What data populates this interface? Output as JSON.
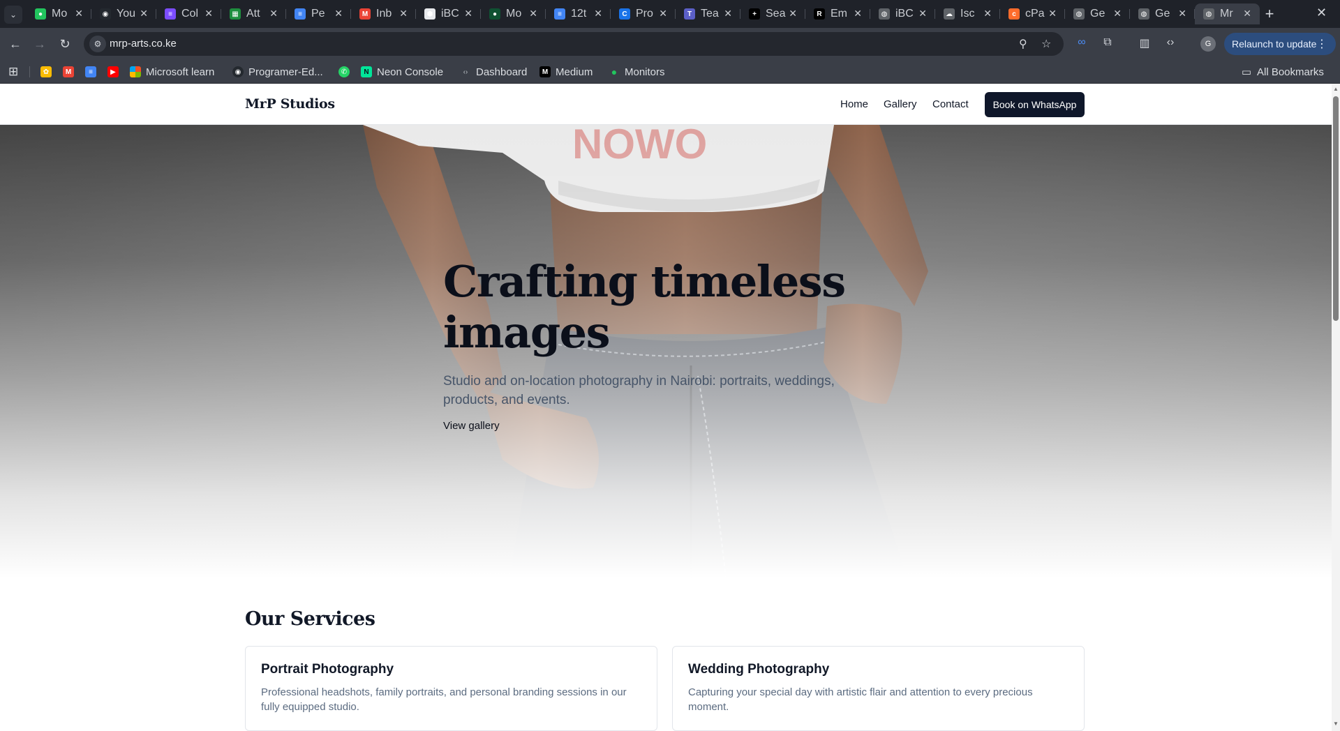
{
  "browser": {
    "tabs": [
      {
        "title": "Mo",
        "icon": "green-dot",
        "color": "#22c55e",
        "glyph": "●"
      },
      {
        "title": "You",
        "icon": "github",
        "color": "#24292f",
        "glyph": "◉"
      },
      {
        "title": "Col",
        "icon": "forms",
        "color": "#7c4dff",
        "glyph": "≡"
      },
      {
        "title": "Att",
        "icon": "sheets",
        "color": "#1e8e3e",
        "glyph": "▦"
      },
      {
        "title": "Pe",
        "icon": "docs",
        "color": "#4285f4",
        "glyph": "≡"
      },
      {
        "title": "Inb",
        "icon": "gmail",
        "color": "#ea4335",
        "glyph": "M"
      },
      {
        "title": "iBC",
        "icon": "ibc",
        "color": "#e8eaed",
        "glyph": "⬢"
      },
      {
        "title": "Mo",
        "icon": "mongo",
        "color": "#0f5132",
        "glyph": "●"
      },
      {
        "title": "12t",
        "icon": "docs",
        "color": "#4285f4",
        "glyph": "≡"
      },
      {
        "title": "Pro",
        "icon": "project",
        "color": "#1a73e8",
        "glyph": "C"
      },
      {
        "title": "Tea",
        "icon": "teams",
        "color": "#5b5fc7",
        "glyph": "T"
      },
      {
        "title": "Sea",
        "icon": "search-plus",
        "color": "#000000",
        "glyph": "+"
      },
      {
        "title": "Em",
        "icon": "r-logo",
        "color": "#000000",
        "glyph": "R"
      },
      {
        "title": "iBC",
        "icon": "globe",
        "color": "#5f6368",
        "glyph": "◍"
      },
      {
        "title": "Isc",
        "icon": "cloud",
        "color": "#5f6368",
        "glyph": "☁"
      },
      {
        "title": "cPa",
        "icon": "cpanel",
        "color": "#ff6c2c",
        "glyph": "c"
      },
      {
        "title": "Ge",
        "icon": "globe",
        "color": "#5f6368",
        "glyph": "◍"
      },
      {
        "title": "Ge",
        "icon": "globe",
        "color": "#5f6368",
        "glyph": "◍"
      },
      {
        "title": "Mr",
        "icon": "globe",
        "color": "#5f6368",
        "glyph": "◍"
      }
    ],
    "url": "mrp-arts.co.ke",
    "relaunch_label": "Relaunch to update",
    "profile_initial": "G",
    "bookmarks": [
      {
        "label": "Microsoft learn"
      },
      {
        "label": "Programer-Ed..."
      },
      {
        "label": "Neon Console"
      },
      {
        "label": "Dashboard"
      },
      {
        "label": "Medium"
      },
      {
        "label": "Monitors"
      }
    ],
    "all_bookmarks_label": "All Bookmarks"
  },
  "site": {
    "brand": "MrP Studios",
    "nav": {
      "home": "Home",
      "gallery": "Gallery",
      "contact": "Contact"
    },
    "cta_label": "Book on WhatsApp"
  },
  "hero": {
    "title": "Crafting timeless images",
    "subtitle": "Studio and on-location photography in Nairobi: portraits, weddings, products, and events.",
    "link": "View gallery"
  },
  "services": {
    "title": "Our Services",
    "items": [
      {
        "title": "Portrait Photography",
        "description": "Professional headshots, family portraits, and personal branding sessions in our fully equipped studio."
      },
      {
        "title": "Wedding Photography",
        "description": "Capturing your special day with artistic flair and attention to every precious moment."
      }
    ]
  },
  "colors": {
    "accent": "#0f172a",
    "chrome_bg": "#3a3e47",
    "tabstrip_bg": "#1f2229",
    "relaunch_bg": "#2c4d7e"
  }
}
